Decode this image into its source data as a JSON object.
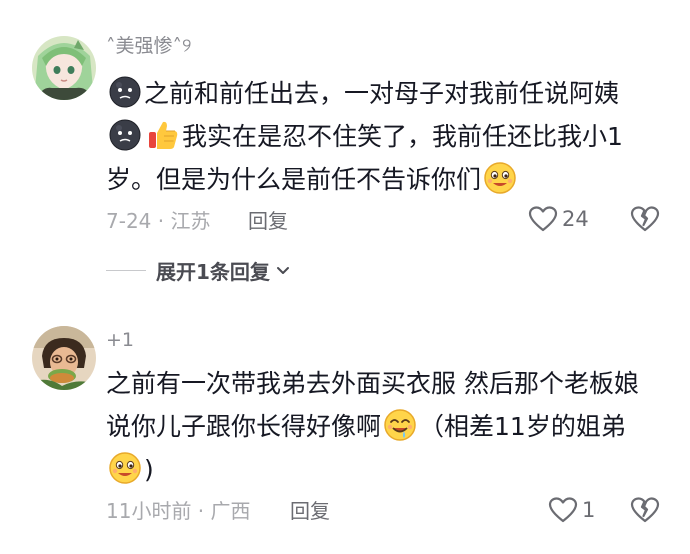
{
  "comments": [
    {
      "username": "˄美强惨˄୨",
      "line1": "之前和前任出去，一对母子对我前任说阿姨",
      "line2": "我实在是忍不住笑了，我前任还比我小1",
      "line3": "岁。但是为什么是前任不告诉你们",
      "meta": "7-24 · 江苏",
      "reply_label": "回复",
      "like_count": "24",
      "expand_label": "展开1条回复"
    },
    {
      "username": "+1",
      "line1": "之前有一次带我弟去外面买衣服 然后那个老板娘",
      "line2a": "说你儿子跟你长得好像啊",
      "line2b": "（相差11岁的姐弟",
      "line3": ")",
      "meta": "11小时前 · 广西",
      "reply_label": "回复",
      "like_count": "1"
    }
  ],
  "icons": {
    "dark_face": "dark-moon-face-emoji",
    "thumbs_up": "thumbs-up-emoji",
    "smile": "smiling-face-emoji",
    "drool": "drooling-face-emoji",
    "like": "heart-outline-icon",
    "dislike": "broken-heart-icon",
    "chevron": "chevron-down-icon"
  },
  "colors": {
    "text_primary": "#161823",
    "text_secondary": "#a8a9ad",
    "emoji_yellow": "#ffd54a"
  }
}
